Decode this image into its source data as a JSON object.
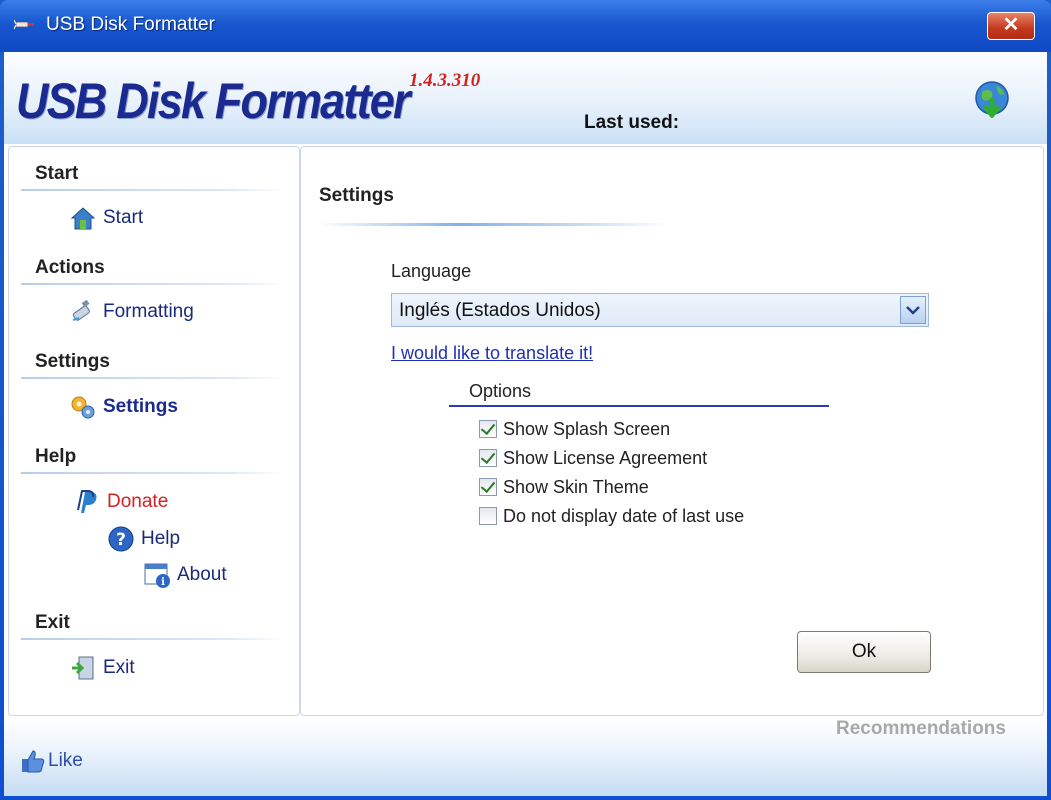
{
  "window": {
    "title": "USB Disk Formatter",
    "close_label": "✕"
  },
  "header": {
    "brand": "USB Disk Formatter",
    "version": "1.4.3.310",
    "last_used_label": "Last used:"
  },
  "sidebar": {
    "sections": [
      {
        "title": "Start",
        "items": [
          {
            "label": "Start",
            "icon": "home-icon"
          }
        ]
      },
      {
        "title": "Actions",
        "items": [
          {
            "label": "Formatting",
            "icon": "usb-drive-icon"
          }
        ]
      },
      {
        "title": "Settings",
        "items": [
          {
            "label": "Settings",
            "icon": "gears-icon",
            "active": true
          }
        ]
      },
      {
        "title": "Help",
        "items": [
          {
            "label": "Donate",
            "icon": "paypal-icon"
          },
          {
            "label": "Help",
            "icon": "question-icon"
          },
          {
            "label": "About",
            "icon": "info-icon"
          }
        ]
      },
      {
        "title": "Exit",
        "items": [
          {
            "label": "Exit",
            "icon": "exit-door-icon"
          }
        ]
      }
    ]
  },
  "settings": {
    "heading": "Settings",
    "language_label": "Language",
    "language_value": "Inglés (Estados Unidos)",
    "translate_link": "I would like to translate it!",
    "options_label": "Options",
    "options": [
      {
        "label": "Show Splash Screen",
        "checked": true
      },
      {
        "label": "Show License Agreement",
        "checked": true
      },
      {
        "label": "Show Skin Theme",
        "checked": true
      },
      {
        "label": "Do not display date of last use",
        "checked": false
      }
    ],
    "ok_label": "Ok"
  },
  "footer": {
    "recommendations": "Recommendations",
    "like_label": "Like"
  },
  "colors": {
    "titlebar": "#1857cf",
    "brand": "#1a2a8f",
    "version": "#d42020",
    "link": "#1f2fb8",
    "donate": "#d42020"
  }
}
